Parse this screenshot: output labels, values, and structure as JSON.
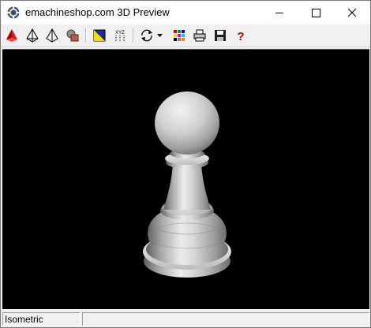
{
  "window": {
    "title": "emachineshop.com 3D Preview",
    "app_icon": "emachineshop-gear-icon",
    "controls": [
      "minimize-icon",
      "maximize-icon",
      "close-icon"
    ]
  },
  "toolbar": {
    "buttons": [
      {
        "name": "solid-view-icon",
        "color": "#d40000"
      },
      {
        "name": "wireframe-view-icon"
      },
      {
        "name": "hidden-line-view-icon"
      },
      {
        "name": "material-view-icon"
      },
      {
        "name": "background-color-icon"
      },
      {
        "name": "axes-icon",
        "text": "XYZ"
      },
      {
        "name": "rotate-icon"
      },
      {
        "name": "rotate-dropdown-icon"
      },
      {
        "name": "color-palette-icon"
      },
      {
        "name": "print-icon"
      },
      {
        "name": "save-icon"
      },
      {
        "name": "help-icon",
        "text": "?",
        "color": "#c00000"
      }
    ]
  },
  "viewport": {
    "background": "#000000",
    "model": "chess-pawn"
  },
  "status": {
    "view_label": "Isometric",
    "message": ""
  }
}
